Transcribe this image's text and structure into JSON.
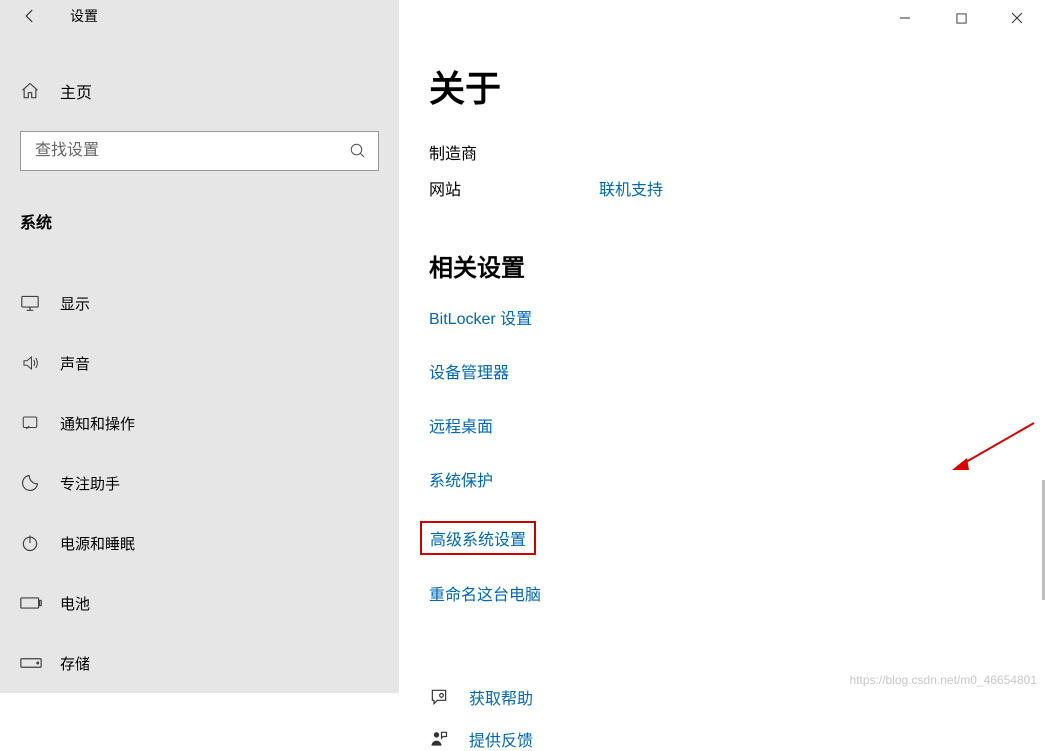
{
  "titlebar": {
    "title": "设置"
  },
  "sidebar": {
    "home_label": "主页",
    "search_placeholder": "查找设置",
    "category": "系统",
    "items": [
      {
        "label": "显示",
        "icon": "display-icon"
      },
      {
        "label": "声音",
        "icon": "sound-icon"
      },
      {
        "label": "通知和操作",
        "icon": "notifications-icon"
      },
      {
        "label": "专注助手",
        "icon": "focus-assist-icon"
      },
      {
        "label": "电源和睡眠",
        "icon": "power-icon"
      },
      {
        "label": "电池",
        "icon": "battery-icon"
      },
      {
        "label": "存储",
        "icon": "storage-icon"
      }
    ]
  },
  "main": {
    "title": "关于",
    "info": {
      "manufacturer_label": "制造商",
      "manufacturer_value": "",
      "website_label": "网站",
      "website_link": "联机支持"
    },
    "related_title": "相关设置",
    "related_links": [
      "BitLocker 设置",
      "设备管理器",
      "远程桌面",
      "系统保护",
      "高级系统设置",
      "重命名这台电脑"
    ],
    "highlight_index": 4,
    "footer": {
      "help": "获取帮助",
      "feedback": "提供反馈"
    }
  },
  "watermark": "https://blog.csdn.net/m0_46654801"
}
